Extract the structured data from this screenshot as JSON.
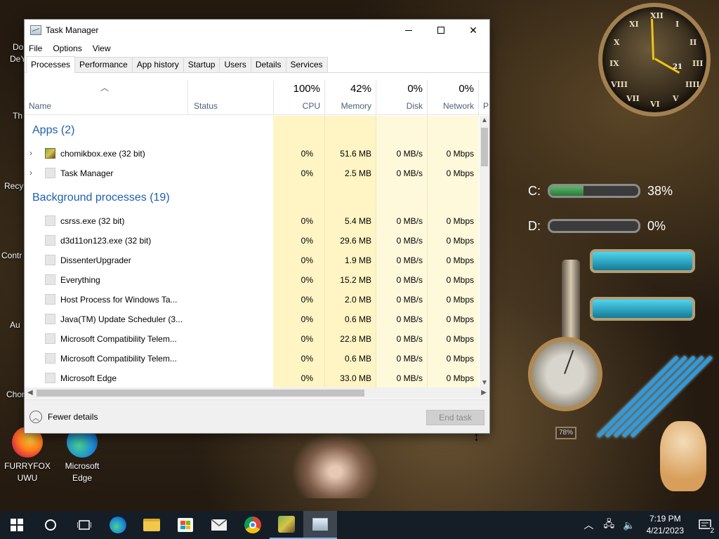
{
  "desktop": {
    "icons": [
      {
        "label": "FURRYFOX UWU"
      },
      {
        "label": "Microsoft Edge"
      }
    ],
    "cropped_labels": [
      "Do",
      "DeY",
      "Th",
      "Recy",
      "Contr",
      "Au",
      "Chon"
    ]
  },
  "task_manager": {
    "title": "Task Manager",
    "menu": [
      "File",
      "Options",
      "View"
    ],
    "tabs": [
      "Processes",
      "Performance",
      "App history",
      "Startup",
      "Users",
      "Details",
      "Services"
    ],
    "active_tab": "Processes",
    "columns": {
      "name": "Name",
      "status": "Status",
      "cpu": {
        "pct": "100%",
        "label": "CPU"
      },
      "memory": {
        "pct": "42%",
        "label": "Memory"
      },
      "disk": {
        "pct": "0%",
        "label": "Disk"
      },
      "network": {
        "pct": "0%",
        "label": "Network"
      },
      "power_cropped": "P"
    },
    "groups": [
      {
        "title": "Apps (2)",
        "rows": [
          {
            "name": "chomikbox.exe (32 bit)",
            "cpu": "0%",
            "memory": "51.6 MB",
            "disk": "0 MB/s",
            "network": "0 Mbps",
            "expandable": true
          },
          {
            "name": "Task Manager",
            "cpu": "0%",
            "memory": "2.5 MB",
            "disk": "0 MB/s",
            "network": "0 Mbps",
            "expandable": true
          }
        ]
      },
      {
        "title": "Background processes (19)",
        "rows": [
          {
            "name": "csrss.exe (32 bit)",
            "cpu": "0%",
            "memory": "5.4 MB",
            "disk": "0 MB/s",
            "network": "0 Mbps"
          },
          {
            "name": "d3d11on123.exe (32 bit)",
            "cpu": "0%",
            "memory": "29.6 MB",
            "disk": "0 MB/s",
            "network": "0 Mbps"
          },
          {
            "name": "DissenterUpgrader",
            "cpu": "0%",
            "memory": "1.9 MB",
            "disk": "0 MB/s",
            "network": "0 Mbps"
          },
          {
            "name": "Everything",
            "cpu": "0%",
            "memory": "15.2 MB",
            "disk": "0 MB/s",
            "network": "0 Mbps"
          },
          {
            "name": "Host Process for Windows Ta...",
            "cpu": "0%",
            "memory": "2.0 MB",
            "disk": "0 MB/s",
            "network": "0 Mbps"
          },
          {
            "name": "Java(TM) Update Scheduler (3...",
            "cpu": "0%",
            "memory": "0.6 MB",
            "disk": "0 MB/s",
            "network": "0 Mbps"
          },
          {
            "name": "Microsoft Compatibility Telem...",
            "cpu": "0%",
            "memory": "22.8 MB",
            "disk": "0 MB/s",
            "network": "0 Mbps"
          },
          {
            "name": "Microsoft Compatibility Telem...",
            "cpu": "0%",
            "memory": "0.6 MB",
            "disk": "0 MB/s",
            "network": "0 Mbps"
          },
          {
            "name": "Microsoft Edge",
            "cpu": "0%",
            "memory": "33.0 MB",
            "disk": "0 MB/s",
            "network": "0 Mbps"
          }
        ]
      }
    ],
    "footer": {
      "fewer_details": "Fewer details",
      "end_task": "End task"
    }
  },
  "widgets": {
    "clock_numerals": [
      "XII",
      "I",
      "II",
      "III",
      "IIII",
      "V",
      "VI",
      "VII",
      "VIII",
      "IX",
      "X",
      "XI"
    ],
    "clock_date": "21",
    "drives": [
      {
        "label": "C:",
        "usage": 0.38,
        "pct_text": "38%"
      },
      {
        "label": "D:",
        "usage": 0.0,
        "pct_text": "0%"
      }
    ],
    "gauge_readout": "78%"
  },
  "taskbar": {
    "time": "7:19 PM",
    "date": "4/21/2023",
    "notification_count": "2",
    "pinned": [
      "start",
      "search",
      "task-view",
      "edge",
      "file-explorer",
      "store",
      "mail",
      "chrome",
      "chomikbox",
      "task-manager"
    ]
  }
}
